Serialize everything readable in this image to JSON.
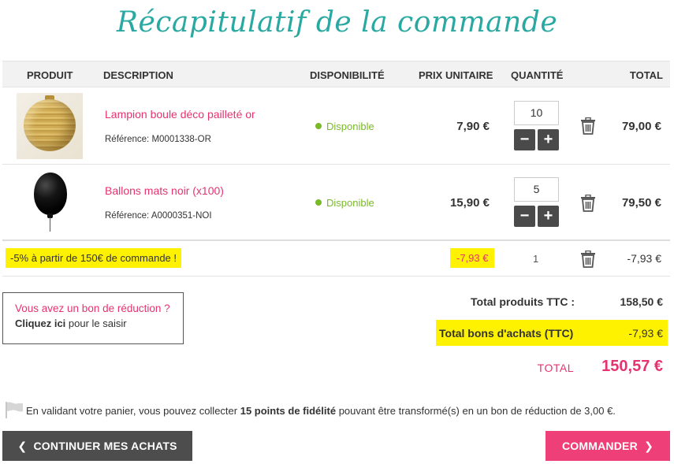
{
  "page": {
    "title": "Récapitulatif de la commande"
  },
  "table": {
    "headers": {
      "product": "PRODUIT",
      "description": "DESCRIPTION",
      "availability": "DISPONIBILITÉ",
      "unit_price": "PRIX UNITAIRE",
      "quantity": "QUANTITÉ",
      "total": "TOTAL"
    },
    "items": [
      {
        "name": "Lampion boule déco pailleté or",
        "reference": "Référence: M0001338-OR",
        "availability": "Disponible",
        "unit_price": "7,90 €",
        "quantity": "10",
        "total": "79,00 €",
        "image_icon": "gold-paper-lantern"
      },
      {
        "name": "Ballons mats noir (x100)",
        "reference": "Référence: A0000351-NOI",
        "availability": "Disponible",
        "unit_price": "15,90 €",
        "quantity": "5",
        "total": "79,50 €",
        "image_icon": "black-balloon"
      }
    ],
    "promotion": {
      "label": "-5% à partir de 150€ de commande !",
      "unit_price": "-7,93 €",
      "quantity": "1",
      "total": "-7,93 €"
    },
    "qty_minus": "−",
    "qty_plus": "+"
  },
  "voucher": {
    "question": "Vous avez un bon de réduction ?",
    "link": "Cliquez ici",
    "suffix": " pour le saisir"
  },
  "summary": {
    "products_label": "Total produits TTC :",
    "products_value": "158,50 €",
    "vouchers_label": "Total bons d'achats (TTC)",
    "vouchers_value": "-7,93 €",
    "total_label": "TOTAL",
    "total_value": "150,57 €"
  },
  "loyalty": {
    "prefix": "En validant votre panier, vous pouvez collecter ",
    "points": "15 points de fidélité",
    "suffix": " pouvant être transformé(s) en un bon de réduction de 3,00 €."
  },
  "buttons": {
    "continue": "CONTINUER MES ACHATS",
    "order": "COMMANDER"
  },
  "colors": {
    "title": "#2aa9a3",
    "accent_pink": "#e5336f",
    "available_green": "#7ab929",
    "highlight_yellow": "#fff200",
    "dark_button": "#4d4d4d",
    "order_button": "#ef3f78"
  }
}
